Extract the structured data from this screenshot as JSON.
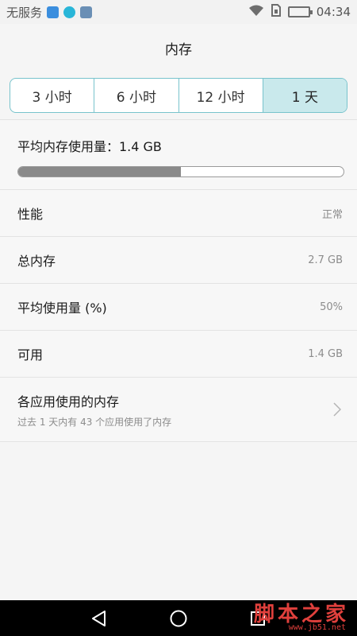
{
  "status_bar": {
    "carrier": "无服务",
    "time": "04:34",
    "icons": [
      "app-icon-blue",
      "app-icon-cyan",
      "app-icon-gallery",
      "wifi-icon",
      "sim-icon",
      "battery-charging-icon"
    ]
  },
  "title": "内存",
  "segments": [
    {
      "label": "3 小时",
      "active": false
    },
    {
      "label": "6 小时",
      "active": false
    },
    {
      "label": "12 小时",
      "active": false
    },
    {
      "label": "1 天",
      "active": true
    }
  ],
  "usage": {
    "title": "平均内存使用量：1.4 GB",
    "fill_fraction": 0.5
  },
  "rows": [
    {
      "label": "性能",
      "value": "正常"
    },
    {
      "label": "总内存",
      "value": "2.7 GB"
    },
    {
      "label": "平均使用量 (%)",
      "value": "50%"
    },
    {
      "label": "可用",
      "value": "1.4 GB"
    }
  ],
  "apps_row": {
    "label": "各应用使用的内存",
    "sub": "过去 1 天内有 43 个应用使用了内存"
  },
  "watermark": {
    "text": "脚本之家",
    "url": "www.jb51.net"
  },
  "colors": {
    "accent_border": "#78c3cc",
    "active_segment": "#c9e9ec",
    "progress_fill": "#8a8a8a"
  }
}
